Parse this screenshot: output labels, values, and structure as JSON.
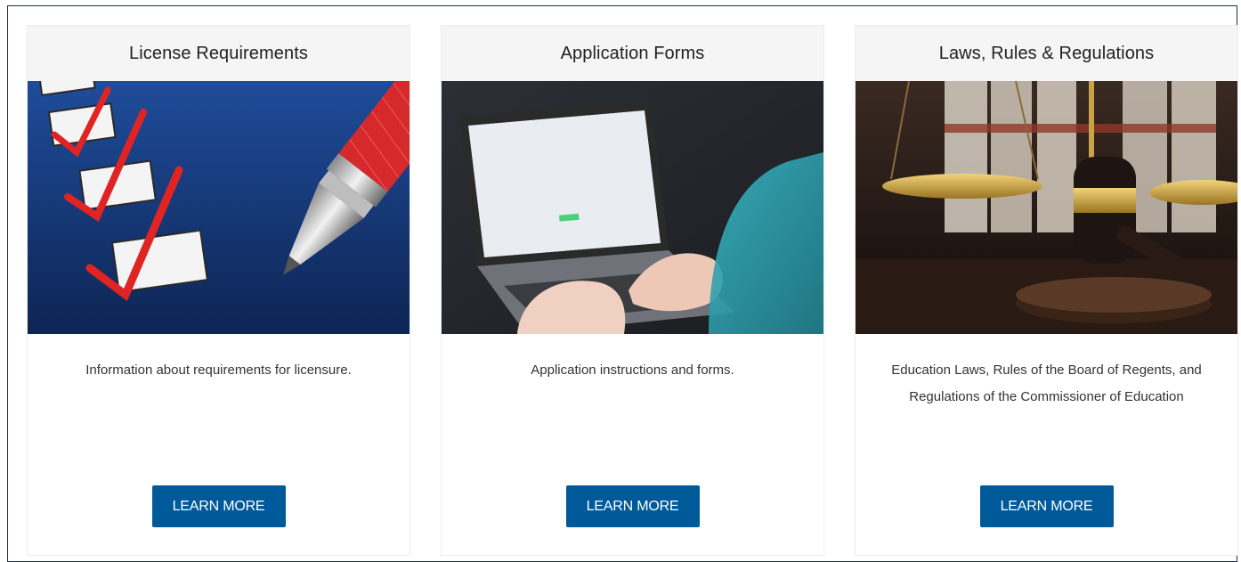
{
  "cards": [
    {
      "title": "License Requirements",
      "image_icon": "checklist-pen-image",
      "description": "Information about requirements for licensure.",
      "button_label": "LEARN MORE"
    },
    {
      "title": "Application Forms",
      "image_icon": "laptop-typing-image",
      "description": "Application instructions and forms.",
      "button_label": "LEARN MORE"
    },
    {
      "title": "Laws, Rules & Regulations",
      "image_icon": "gavel-scales-image",
      "description": "Education Laws, Rules of the Board of Regents, and Regulations of the Commissioner of Education",
      "button_label": "LEARN MORE"
    }
  ],
  "colors": {
    "button": "#005a99",
    "header_bg": "#f5f5f5",
    "frame_border": "#1f3347"
  }
}
